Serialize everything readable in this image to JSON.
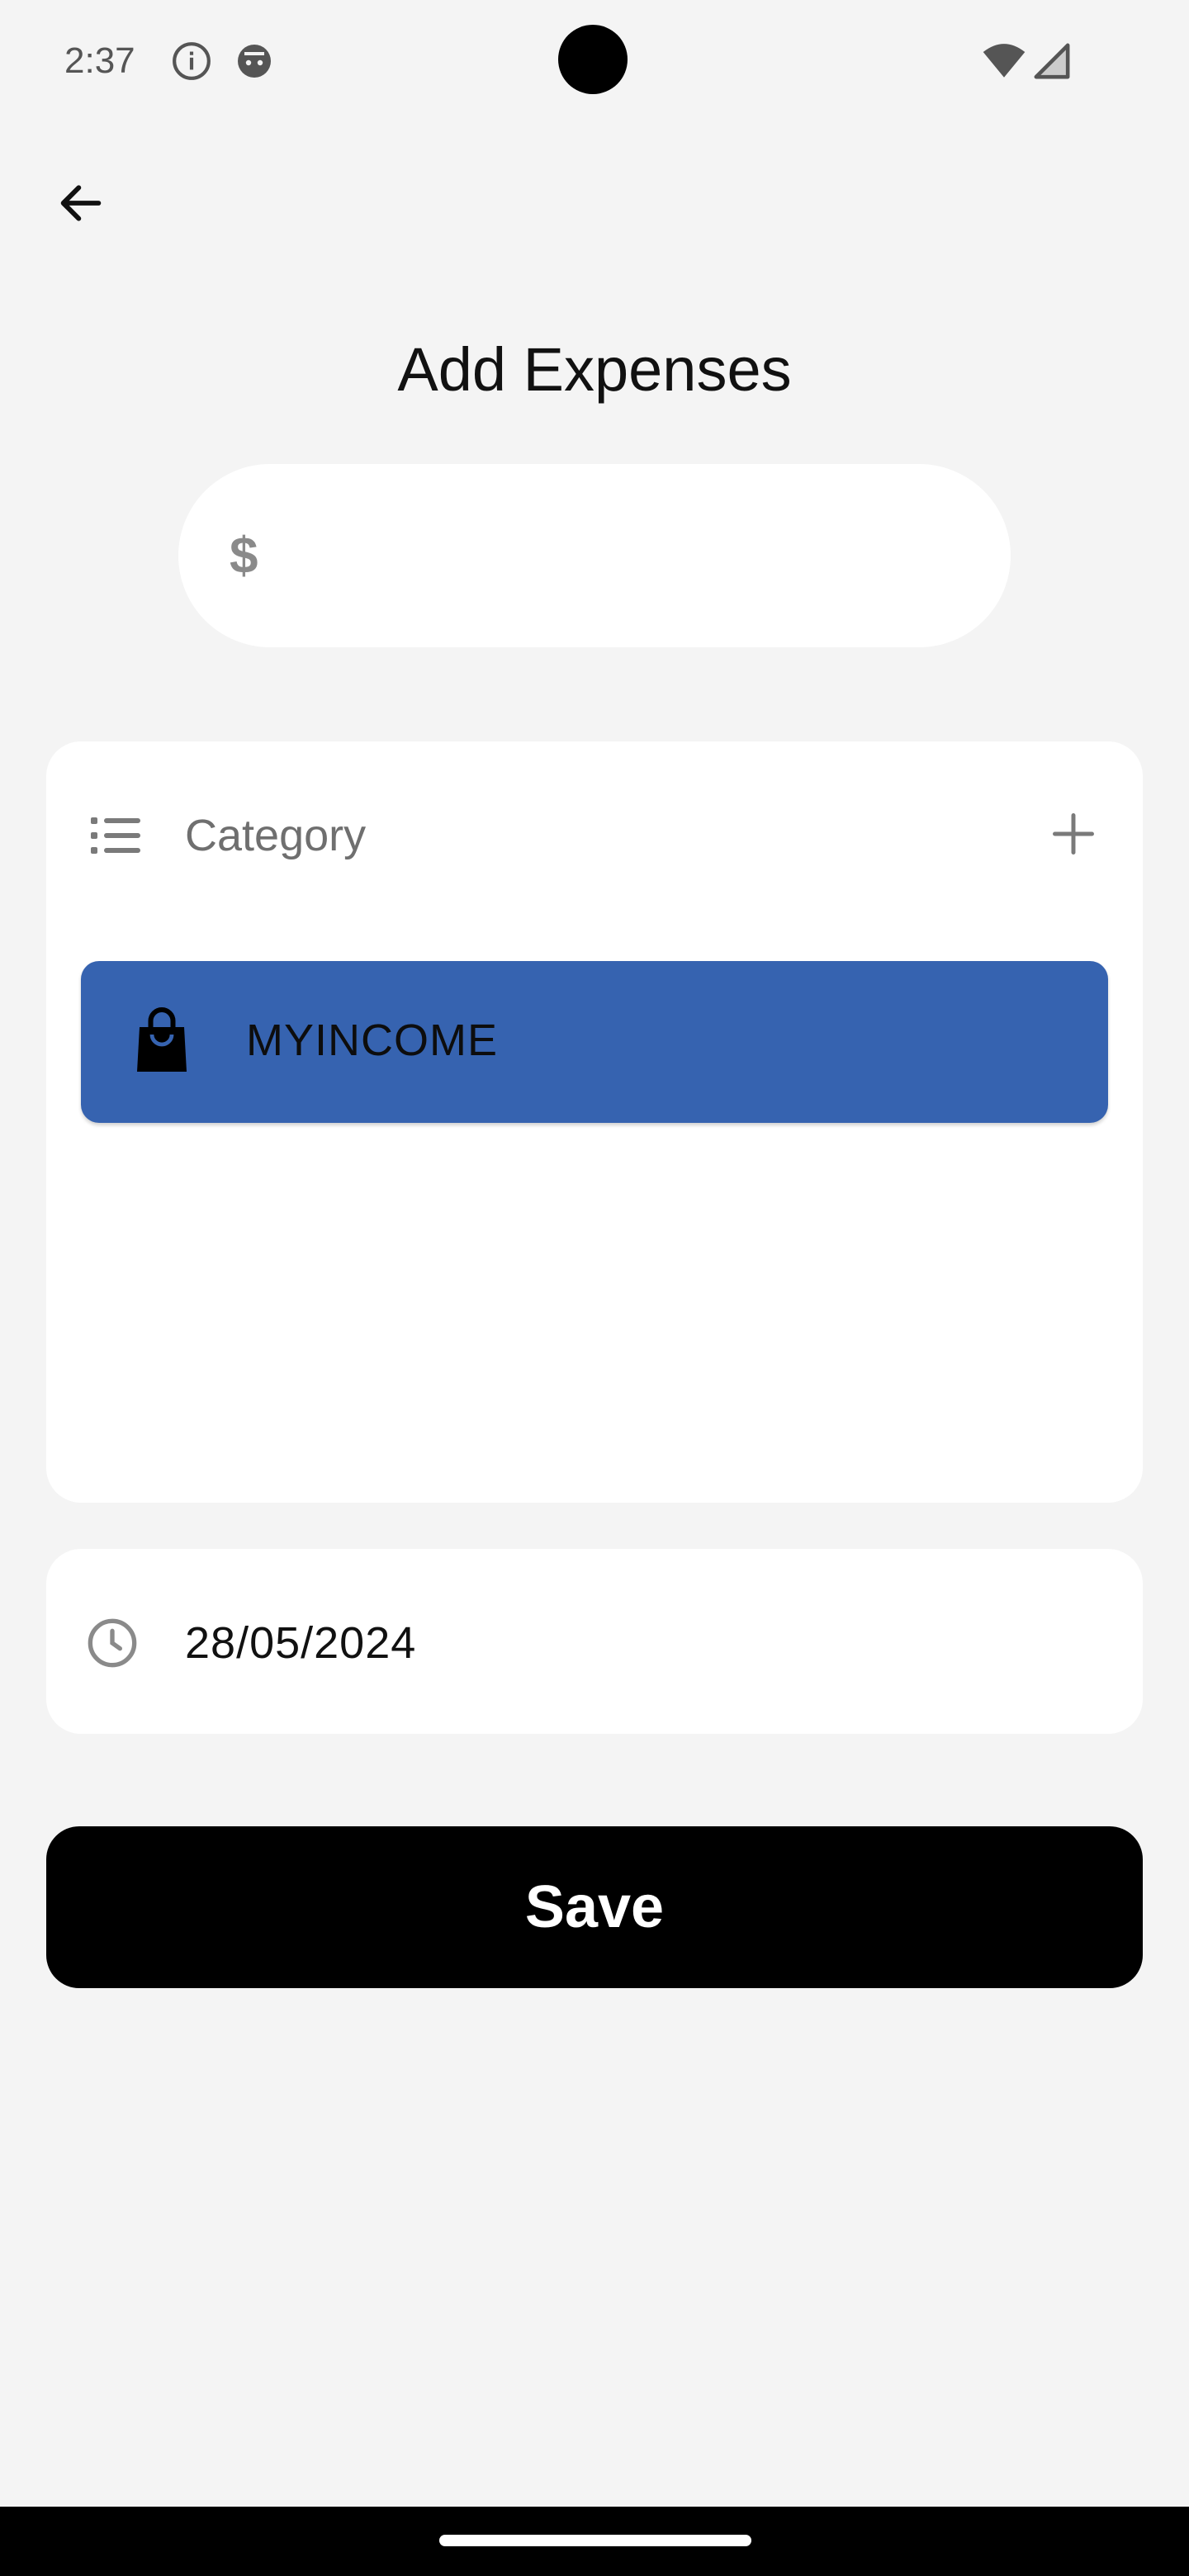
{
  "status_bar": {
    "time": "2:37",
    "icons": [
      "info-icon",
      "android-debug-icon",
      "wifi-icon",
      "cellular-signal-icon"
    ]
  },
  "header": {
    "back_icon": "arrow-left-icon",
    "title": "Add Expenses"
  },
  "amount": {
    "currency_symbol": "$",
    "value": "",
    "placeholder": ""
  },
  "category": {
    "header_icon": "list-icon",
    "label": "Category",
    "add_icon": "plus-icon",
    "items": [
      {
        "label": "MYINCOME",
        "icon": "shopping-bag-icon",
        "color": "#3663b0"
      }
    ]
  },
  "date": {
    "icon": "clock-icon",
    "value": "28/05/2024"
  },
  "actions": {
    "save_label": "Save"
  },
  "colors": {
    "background": "#f4f4f4",
    "card": "#ffffff",
    "accent": "#3663b0",
    "primary_button": "#000000"
  }
}
